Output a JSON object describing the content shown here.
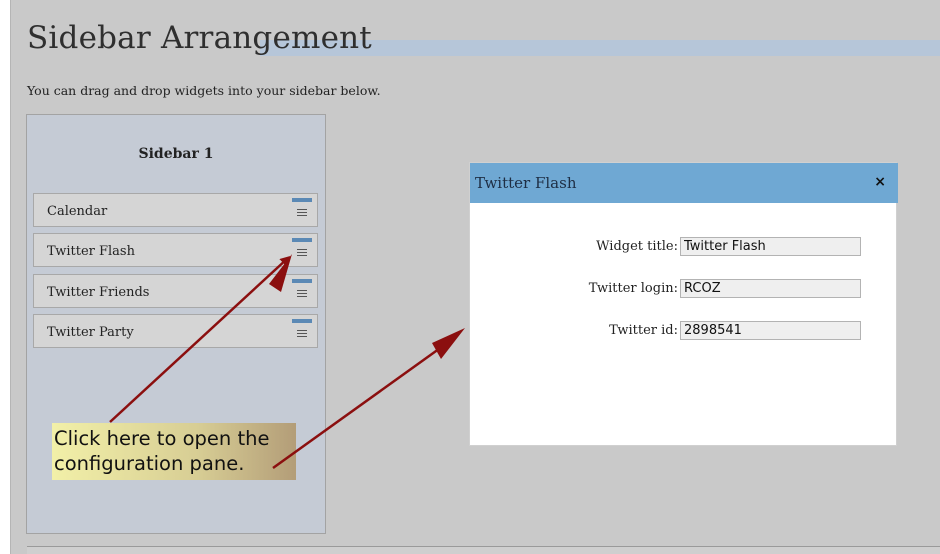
{
  "page": {
    "title": "Sidebar Arrangement",
    "instructions": "You can drag and drop widgets into your sidebar below."
  },
  "sidebar": {
    "title": "Sidebar 1",
    "widgets": [
      {
        "label": "Calendar"
      },
      {
        "label": "Twitter Flash"
      },
      {
        "label": "Twitter Friends"
      },
      {
        "label": "Twitter Party"
      }
    ]
  },
  "callout": {
    "text": "Click here to open the\nconfiguration pane."
  },
  "dialog": {
    "title": "Twitter Flash",
    "close_symbol": "×",
    "fields": [
      {
        "label": "Widget title:",
        "value": "Twitter Flash"
      },
      {
        "label": "Twitter login:",
        "value": "RCOZ"
      },
      {
        "label": "Twitter id:",
        "value": "2898541"
      }
    ]
  },
  "colors": {
    "dialog_header": "#6fa8d3",
    "handle_bar": "#5b89b5",
    "arrow": "#8b0f0f",
    "callout_bg": "#f2f0a8"
  }
}
